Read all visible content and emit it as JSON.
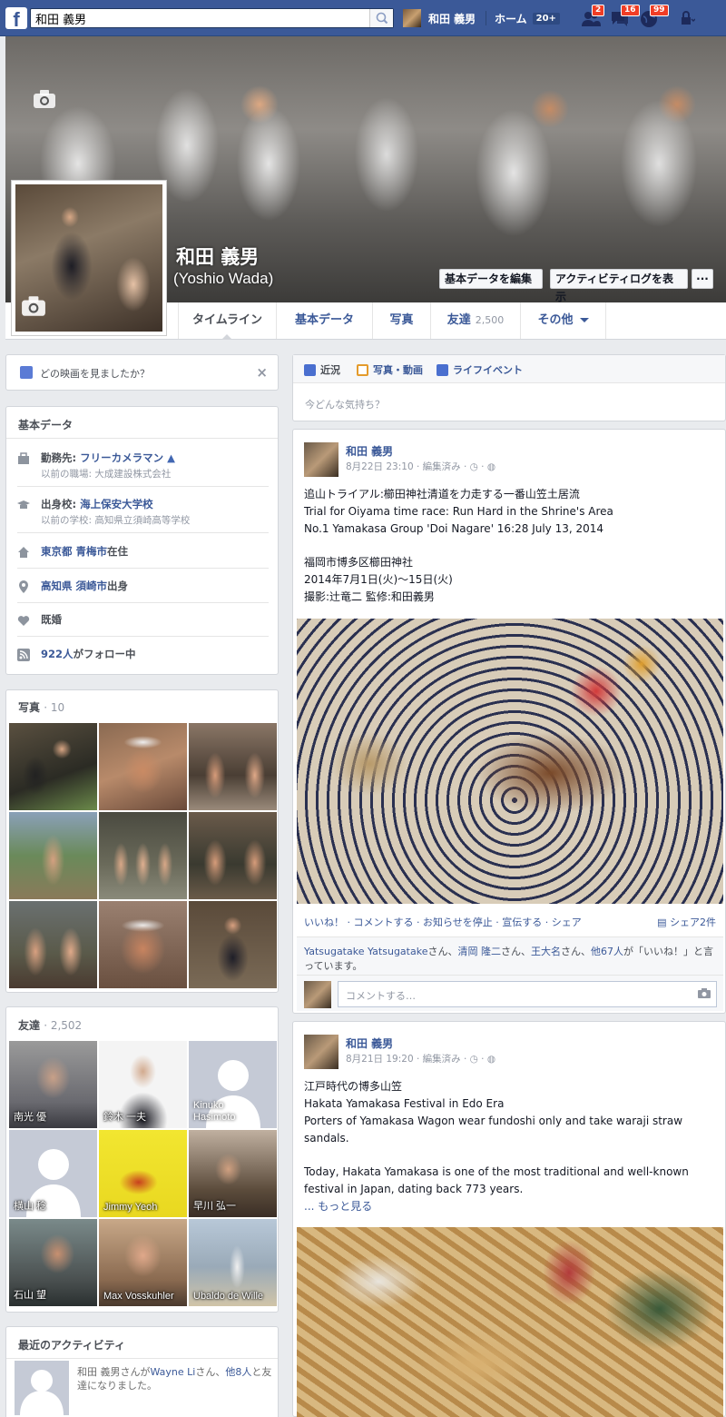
{
  "topbar": {
    "logo": "f",
    "search_value": "和田 義男",
    "user_name": "和田 義男",
    "home_label": "ホーム",
    "home_count": "20+",
    "friend_requests_count": "2",
    "messages_count": "16",
    "notifications_count": "99"
  },
  "cover": {
    "name": "和田 義男",
    "alt_name": "(Yoshio Wada)",
    "edit_button": "基本データを編集",
    "activity_log_button": "アクティビティログを表示",
    "more_button": "···"
  },
  "nav": {
    "tabs": [
      {
        "label": "タイムライン",
        "count": ""
      },
      {
        "label": "基本データ",
        "count": ""
      },
      {
        "label": "写真",
        "count": ""
      },
      {
        "label": "友達",
        "count": "2,500"
      },
      {
        "label": "その他",
        "count": ""
      }
    ]
  },
  "movie_prompt": {
    "text": "どの映画を見ましたか？",
    "close": "×"
  },
  "about": {
    "title": "基本データ",
    "items": [
      {
        "icon": "briefcase-icon",
        "label": "勤務先: ",
        "link": "フリーカメラマン",
        "sub": "以前の職場: 大成建設株式会社"
      },
      {
        "icon": "graduation-cap-icon",
        "label": "出身校: ",
        "link": "海上保安大学校",
        "sub": "以前の学校: 高知県立須崎高等学校"
      },
      {
        "icon": "house-icon",
        "label": "",
        "link": "東京都 青梅市",
        "suffix": "在住",
        "sub": ""
      },
      {
        "icon": "map-pin-icon",
        "label": "",
        "link": "高知県 須崎市",
        "suffix": "出身",
        "sub": ""
      },
      {
        "icon": "heart-icon",
        "label": "既婚",
        "link": "",
        "sub": ""
      },
      {
        "icon": "rss-icon",
        "label": "",
        "link": "922人",
        "suffix": "がフォロー中",
        "sub": ""
      }
    ]
  },
  "photos": {
    "title": "写真",
    "count": "· 10"
  },
  "friends": {
    "title": "友達",
    "count": "· 2,502",
    "list": [
      {
        "name": "南光 優"
      },
      {
        "name": "鈴木 一夫"
      },
      {
        "name": "Kinuko\nHasimoto"
      },
      {
        "name": "横山 稔"
      },
      {
        "name": "Jimmy Yeoh"
      },
      {
        "name": "早川 弘一"
      },
      {
        "name": "石山 望"
      },
      {
        "name": "Max Vosskuhler"
      },
      {
        "name": "Ubaldo de Wille"
      }
    ]
  },
  "activity": {
    "title": "最近のアクティビティ",
    "text_pre": "和田 義男さんが",
    "link1": "Wayne Li",
    "text_mid": "さん、",
    "link2": "他8人",
    "text_post": "と友達になりました。"
  },
  "composer": {
    "tabs": [
      {
        "label": "近況",
        "icon": "pencil-icon"
      },
      {
        "label": "写真・動画",
        "icon": "photo-icon"
      },
      {
        "label": "ライフイベント",
        "icon": "flag-icon"
      }
    ],
    "placeholder": "今どんな気持ち？"
  },
  "posts": [
    {
      "author": "和田 義男",
      "meta": "8月22日 23:10 · 編集済み · ◷ · ◍",
      "lines": [
        "追山トライアル:櫛田神社清道を力走する一番山笠土居流",
        "Trial for Oiyama time race: Run Hard in the Shrine's Area",
        "No.1 Yamakasa Group 'Doi Nagare' 16:28 July 13, 2014",
        "",
        "福岡市博多区櫛田神社",
        "2014年7月1日(火)～15日(火)",
        "撮影:辻竜二  監修:和田義男"
      ],
      "actions": "いいね！ · コメントする · お知らせを停止 · 宣伝する · シェア",
      "share_count": "シェア2件",
      "likes_link1": "Yatsugatake Yatsugatake",
      "likes_sep1": "さん、",
      "likes_link2": "清岡 隆二",
      "likes_sep2": "さん、",
      "likes_link3": "王大名",
      "likes_sep3": "さん、",
      "likes_link4": "他67人",
      "likes_tail": "が「いいね！」と言っています。",
      "comment_placeholder": "コメントする…"
    },
    {
      "author": "和田 義男",
      "meta": "8月21日 19:20 · 編集済み · ◷ · ◍",
      "lines": [
        "江戸時代の博多山笠",
        "Hakata Yamakasa Festival in Edo Era",
        "Porters of Yamakasa Wagon wear fundoshi only and take waraji straw",
        "sandals.",
        "",
        "Today, Hakata Yamakasa is one of the most traditional and well-known",
        "festival in Japan, dating back 773 years."
      ],
      "more": "... もっと見る"
    }
  ]
}
